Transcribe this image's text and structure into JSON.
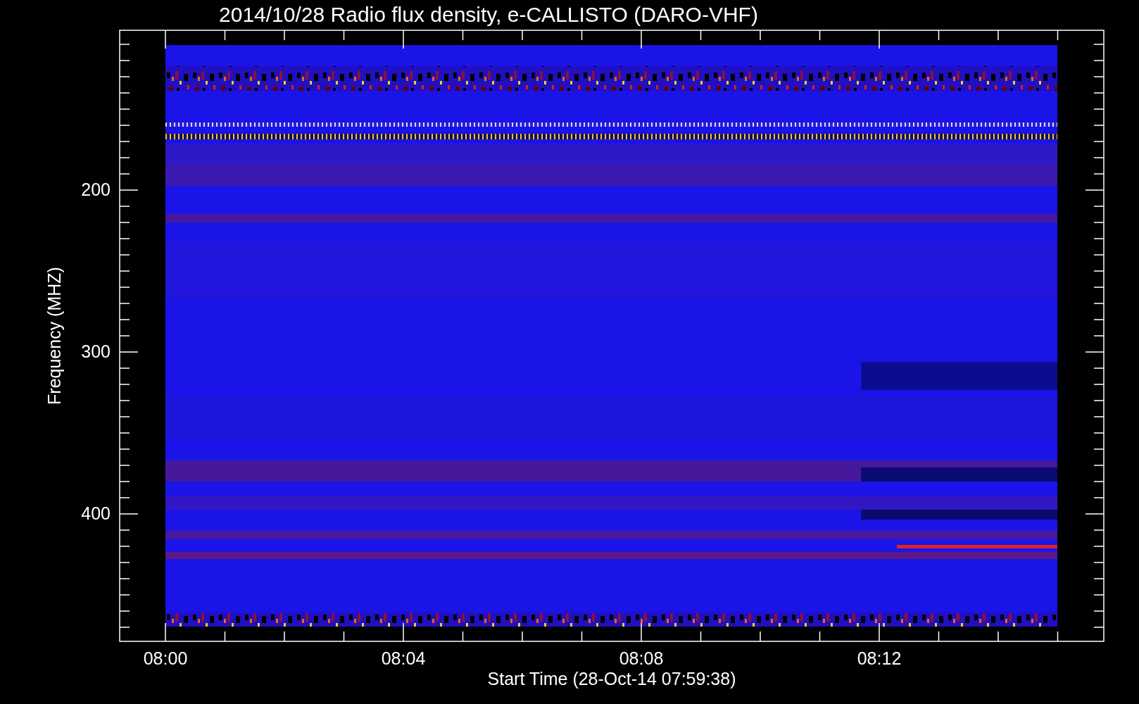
{
  "title": "2014/10/28  Radio flux density, e-CALLISTO (DARO-VHF)",
  "y_axis": {
    "label": "Frequency (MHZ)",
    "ticks": [
      "200",
      "300",
      "400"
    ]
  },
  "x_axis": {
    "label": "Start Time (28-Oct-14 07:59:38)",
    "ticks": [
      "08:00",
      "08:04",
      "08:08",
      "08:12"
    ]
  }
}
